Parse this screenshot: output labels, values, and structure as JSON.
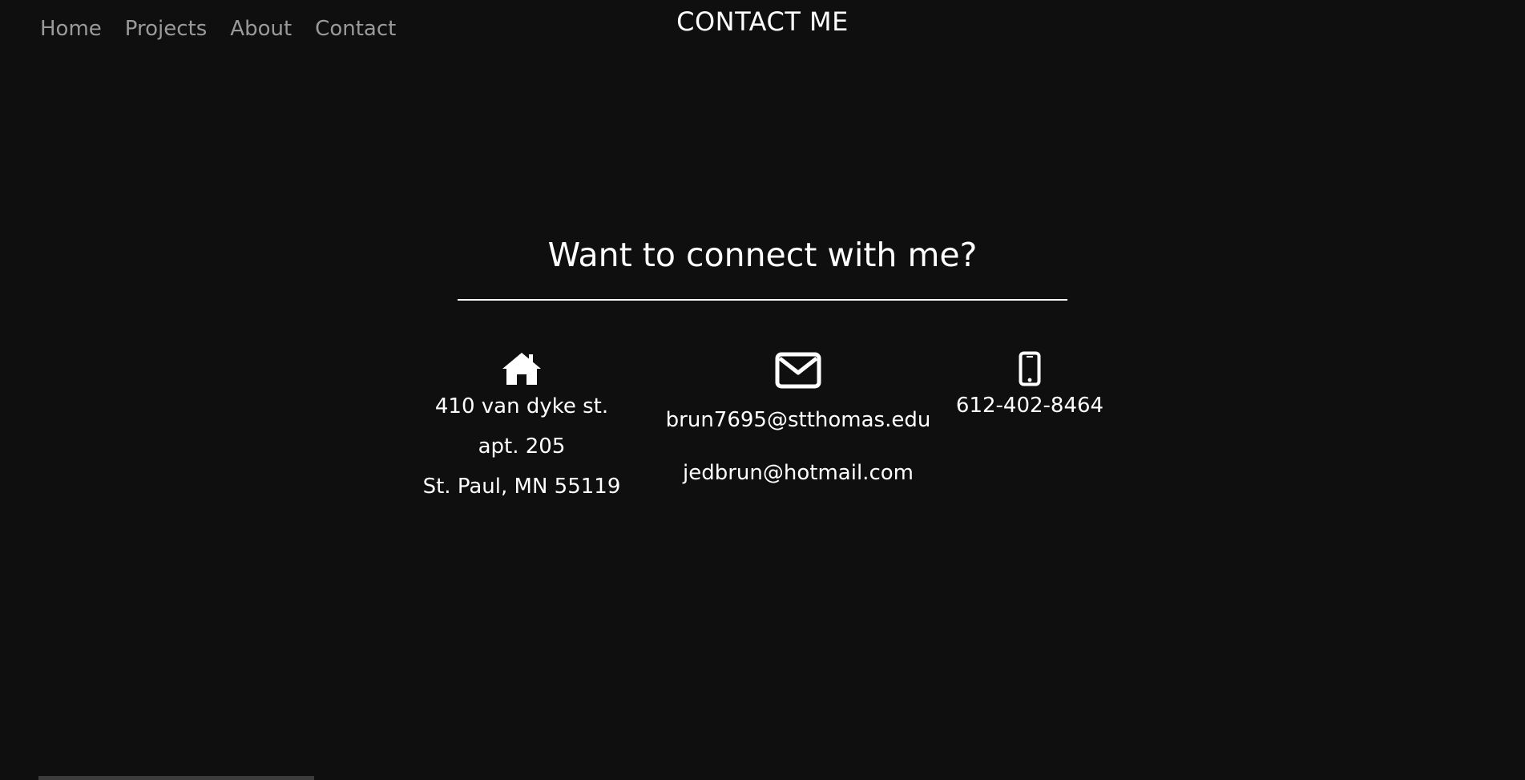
{
  "nav": {
    "items": [
      {
        "label": "Home"
      },
      {
        "label": "Projects"
      },
      {
        "label": "About"
      },
      {
        "label": "Contact"
      }
    ]
  },
  "page_title": "CONTACT ME",
  "headline": "Want to connect with me?",
  "contact": {
    "address": {
      "icon": "home-icon",
      "lines": [
        "410 van dyke st.",
        "apt. 205",
        "St. Paul, MN 55119"
      ]
    },
    "email": {
      "icon": "envelope-icon",
      "addresses": [
        "brun7695@stthomas.edu",
        "jedbrun@hotmail.com"
      ]
    },
    "phone": {
      "icon": "mobile-phone-icon",
      "number": "612-402-8464"
    }
  }
}
